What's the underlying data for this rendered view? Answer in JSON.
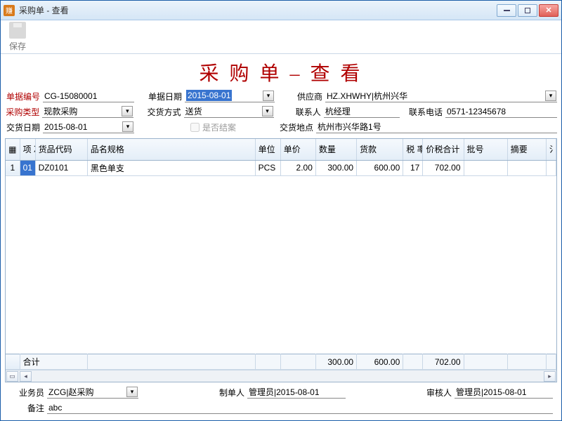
{
  "window": {
    "title": "采购单 - 查看"
  },
  "toolbar": {
    "save": "保存"
  },
  "heading": "采 购 单 – 查 看",
  "labels": {
    "docNo": "单据编号",
    "docDate": "单据日期",
    "supplier": "供应商",
    "buyType": "采购类型",
    "delivery": "交货方式",
    "contact": "联系人",
    "phone": "联系电话",
    "payDate": "交货日期",
    "closed": "是否结案",
    "addr": "交货地点",
    "total": "合计",
    "clerk": "业务员",
    "maker": "制单人",
    "auditor": "审核人",
    "remark": "备注"
  },
  "values": {
    "docNo": "CG-15080001",
    "docDate": "2015-08-01",
    "supplier": "HZ.XHWHY|杭州兴华",
    "buyType": "现款采购",
    "delivery": "送货",
    "contact": "杭经理",
    "phone": "0571-12345678",
    "payDate": "2015-08-01",
    "addr": "杭州市兴华路1号",
    "clerk": "ZCG|赵采购",
    "maker": "管理员|2015-08-01",
    "auditor": "管理员|2015-08-01",
    "remark": "abc"
  },
  "columns": {
    "seq": "项\n次",
    "code": "货品代码",
    "spec": "品名规格",
    "unit": "单位",
    "price": "单价",
    "qty": "数量",
    "amt": "货款",
    "rate": "税\n率%",
    "tax": "价税合计",
    "batch": "批号",
    "remark": "摘要"
  },
  "rows": [
    {
      "idx": "1",
      "seq": "01",
      "code": "DZ0101",
      "spec": "黑色单支",
      "unit": "PCS",
      "price": "2.00",
      "qty": "300.00",
      "amt": "600.00",
      "rate": "17",
      "tax": "702.00",
      "batch": "",
      "remark": ""
    }
  ],
  "totals": {
    "qty": "300.00",
    "amt": "600.00",
    "tax": "702.00"
  }
}
